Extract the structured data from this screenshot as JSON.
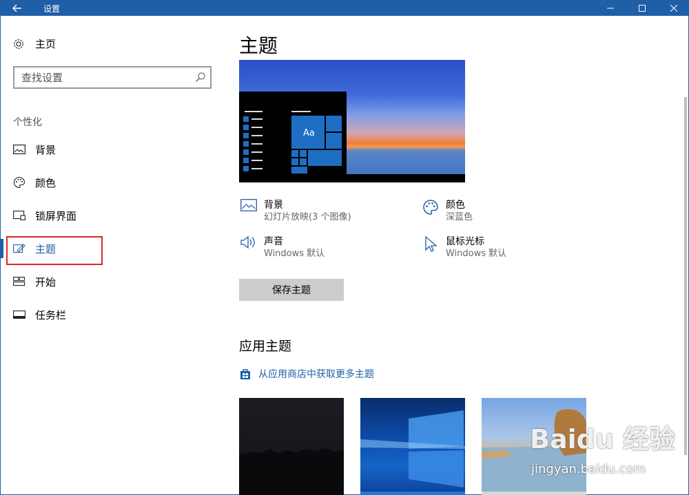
{
  "window": {
    "title": "设置"
  },
  "sidebar": {
    "home_label": "主页",
    "search_placeholder": "查找设置",
    "section_label": "个性化",
    "items": [
      {
        "label": "背景",
        "icon": "picture-icon"
      },
      {
        "label": "颜色",
        "icon": "palette-icon"
      },
      {
        "label": "锁屏界面",
        "icon": "lockscreen-icon"
      },
      {
        "label": "主题",
        "icon": "theme-brush-icon",
        "active": true
      },
      {
        "label": "开始",
        "icon": "start-icon"
      },
      {
        "label": "任务栏",
        "icon": "taskbar-icon"
      }
    ]
  },
  "main": {
    "title": "主题",
    "preview_tile_label": "Aa",
    "properties": [
      {
        "name": "背景",
        "value": "幻灯片放映(3 个图像)",
        "icon": "picture-icon"
      },
      {
        "name": "颜色",
        "value": "深蓝色",
        "icon": "palette-icon"
      },
      {
        "name": "声音",
        "value": "Windows 默认",
        "icon": "speaker-icon"
      },
      {
        "name": "鼠标光标",
        "value": "Windows 默认",
        "icon": "cursor-icon"
      }
    ],
    "save_button": "保存主题",
    "apply_title": "应用主题",
    "store_link": "从应用商店中获取更多主题"
  },
  "watermark": {
    "line1": "Baidu 经验",
    "line2": "jingyan.baidu.com"
  },
  "colors": {
    "accent": "#1f5fa8",
    "highlight_box": "#e02525"
  }
}
